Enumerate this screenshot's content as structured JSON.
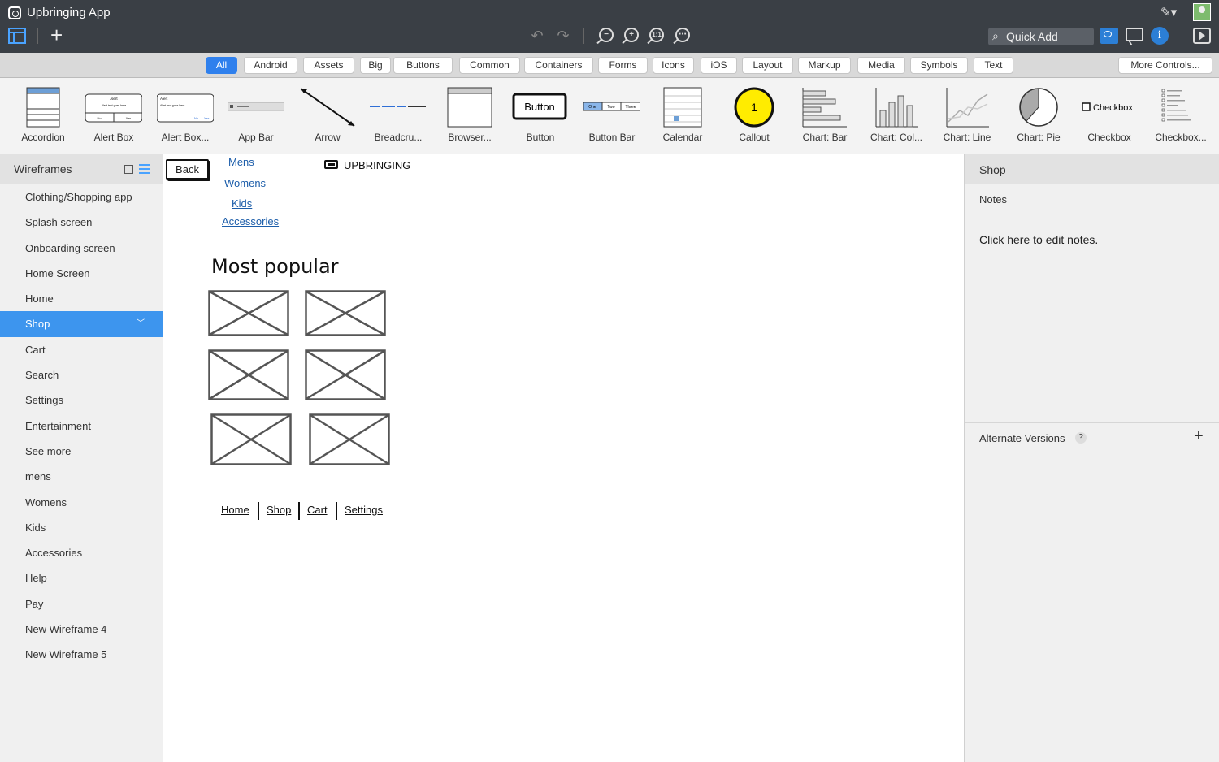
{
  "app": {
    "title": "Upbringing App"
  },
  "toolbar": {
    "quick_add_placeholder": "Quick Add"
  },
  "filters": [
    "All",
    "Android",
    "Assets",
    "Big",
    "Buttons",
    "Common",
    "Containers",
    "Forms",
    "Icons",
    "iOS",
    "Layout",
    "Markup",
    "Media",
    "Symbols",
    "Text"
  ],
  "filters_active": "All",
  "more_controls": "More Controls...",
  "library": [
    {
      "label": "Accordion",
      "icon": "accordion-icon"
    },
    {
      "label": "Alert Box",
      "icon": "alert-box-icon"
    },
    {
      "label": "Alert Box...",
      "icon": "alert-box-2-icon"
    },
    {
      "label": "App Bar",
      "icon": "app-bar-icon"
    },
    {
      "label": "Arrow",
      "icon": "arrow-icon"
    },
    {
      "label": "Breadcru...",
      "icon": "breadcrumb-icon"
    },
    {
      "label": "Browser...",
      "icon": "browser-icon"
    },
    {
      "label": "Button",
      "icon": "button-icon"
    },
    {
      "label": "Button Bar",
      "icon": "button-bar-icon"
    },
    {
      "label": "Calendar",
      "icon": "calendar-icon"
    },
    {
      "label": "Callout",
      "icon": "callout-icon"
    },
    {
      "label": "Chart: Bar",
      "icon": "chart-bar-icon"
    },
    {
      "label": "Chart: Col...",
      "icon": "chart-column-icon"
    },
    {
      "label": "Chart: Line",
      "icon": "chart-line-icon"
    },
    {
      "label": "Chart: Pie",
      "icon": "chart-pie-icon"
    },
    {
      "label": "Checkbox",
      "icon": "checkbox-icon"
    },
    {
      "label": "Checkbox...",
      "icon": "checkbox-group-icon"
    }
  ],
  "library_text": {
    "alert": "Alert",
    "alert_body": "Alert text goes here",
    "no": "No",
    "yes": "Yes",
    "button": "Button",
    "bar_one": "One",
    "bar_two": "Two",
    "bar_three": "Three",
    "callout_num": "1",
    "checkbox": "Checkbox"
  },
  "sidebar": {
    "title": "Wireframes",
    "items": [
      "Clothing/Shopping app",
      "Splash screen",
      "Onboarding screen",
      "Home Screen",
      "Home",
      "Shop",
      "Cart",
      "Search",
      "Settings",
      "Entertainment",
      "See more",
      "mens",
      "Womens",
      "Kids",
      "Accessories",
      "Help",
      "Pay",
      "New Wireframe 4",
      "New Wireframe 5"
    ],
    "active": "Shop"
  },
  "canvas": {
    "back_label": "Back",
    "nav_links": [
      "Mens",
      "Womens",
      "Kids",
      "Accessories"
    ],
    "brand": "UPBRINGING",
    "heading": "Most popular",
    "bottom_nav": [
      "Home",
      "Shop",
      "Cart",
      "Settings"
    ]
  },
  "right_panel": {
    "title": "Shop",
    "notes_label": "Notes",
    "notes_text": "Click here to edit notes.",
    "alternate_versions": "Alternate Versions",
    "help": "?"
  }
}
